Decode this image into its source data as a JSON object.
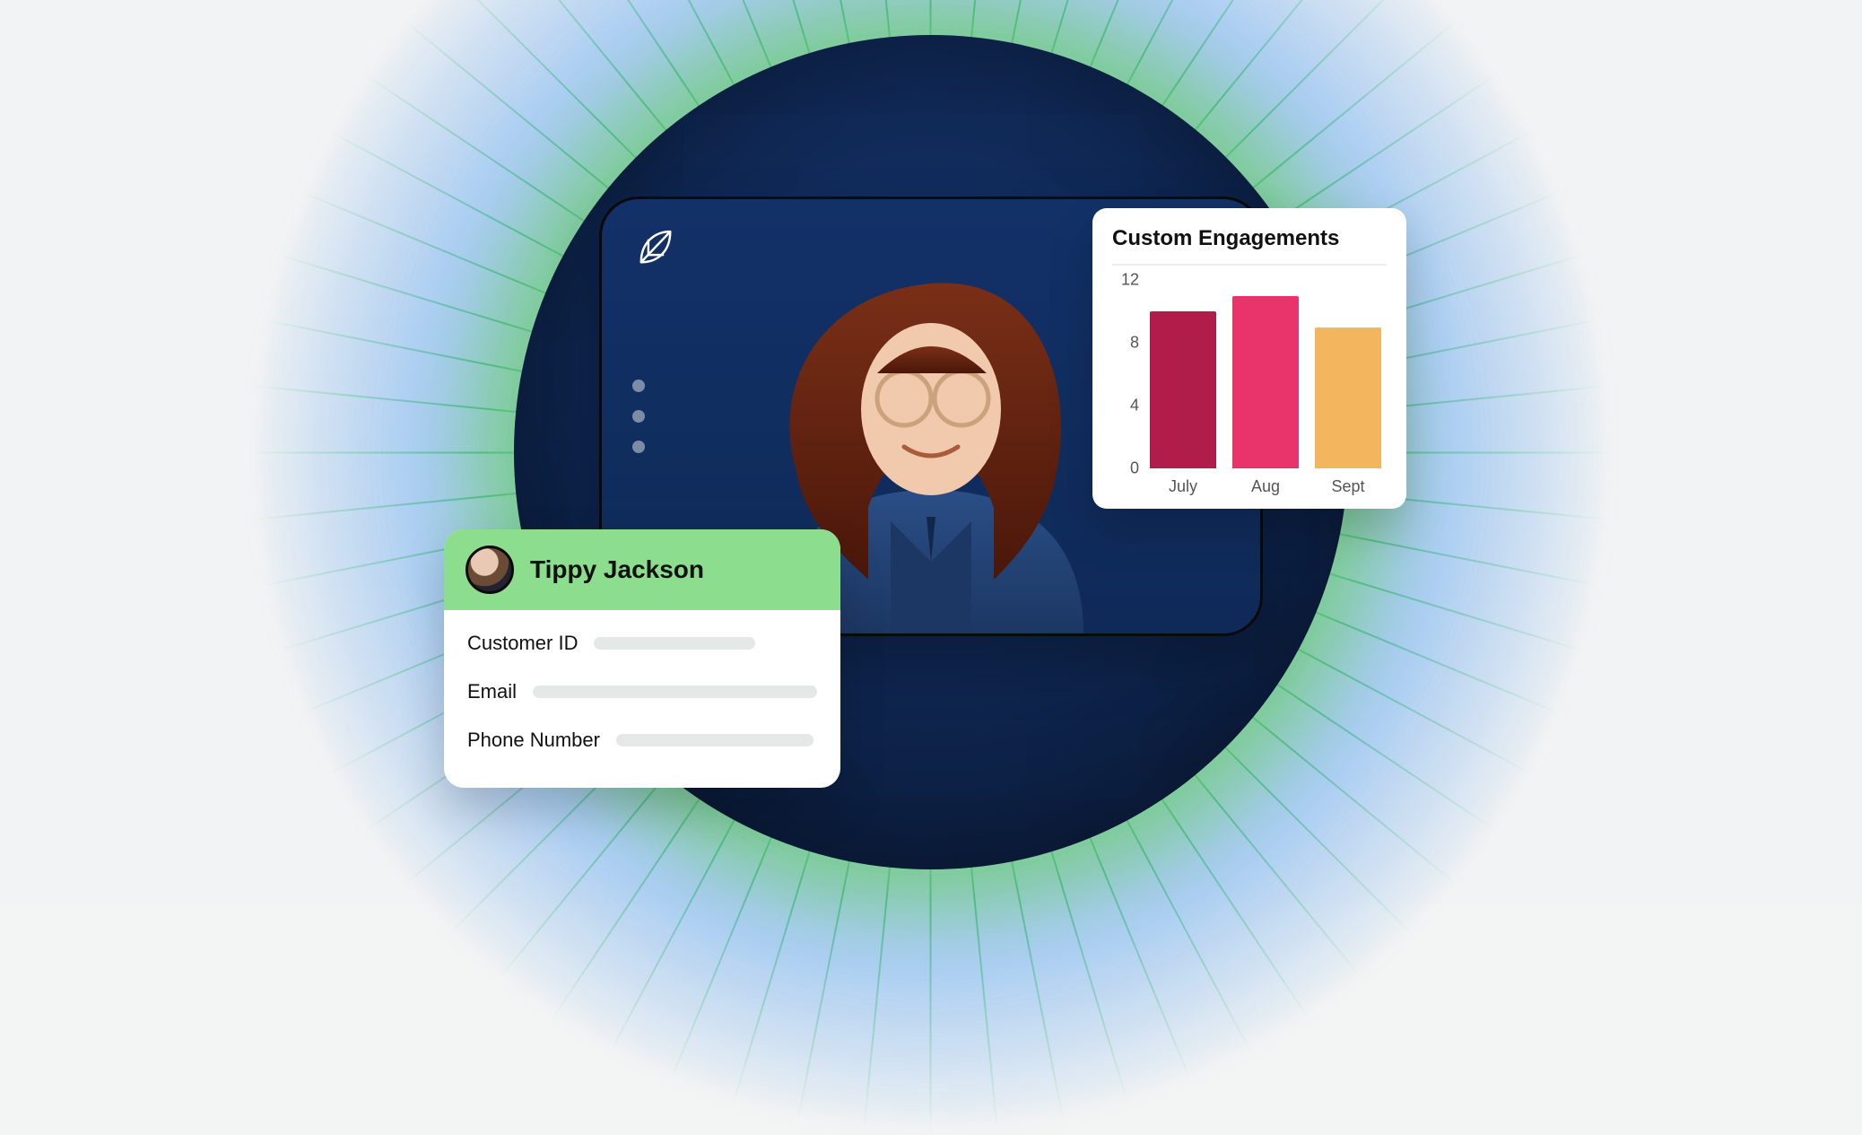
{
  "profile": {
    "name": "Tippy Jackson",
    "fields": [
      {
        "label": "Customer ID"
      },
      {
        "label": "Email"
      },
      {
        "label": "Phone Number"
      }
    ]
  },
  "chart_data": {
    "type": "bar",
    "title": "Custom Engagements",
    "categories": [
      "July",
      "Aug",
      "Sept"
    ],
    "values": [
      10,
      11,
      9
    ],
    "colors": [
      "#b11d4a",
      "#e8336b",
      "#f3b65e"
    ],
    "ylim": [
      0,
      12
    ],
    "y_ticks": [
      12,
      8,
      4,
      0
    ],
    "xlabel": "",
    "ylabel": ""
  }
}
